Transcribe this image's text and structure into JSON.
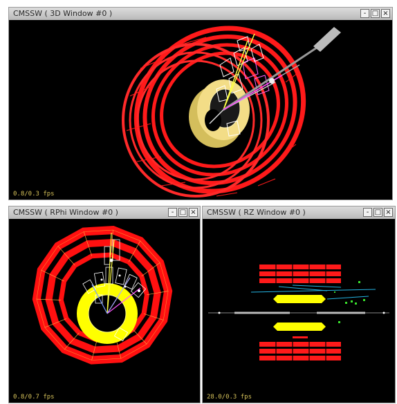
{
  "app": "CMSSW",
  "windows": {
    "three_d": {
      "title": "CMSSW ( 3D Window #0 )",
      "fps": "0.8/0.3 fps"
    },
    "rphi": {
      "title": "CMSSW ( RPhi Window #0 )",
      "fps": "0.8/0.7 fps"
    },
    "rz": {
      "title": "CMSSW ( RZ Window #0 )",
      "fps": "28.0/0.3 fps"
    }
  },
  "controls": {
    "minimize": "-",
    "maximize": "□",
    "close": "×"
  },
  "colors": {
    "calorimeter_red": "#ff1010",
    "tracker_yellow": "#ffff00",
    "tracker_gold": "#f2dc86",
    "tracks_blue": "#25b6e6",
    "hits_green": "#39e12d"
  }
}
